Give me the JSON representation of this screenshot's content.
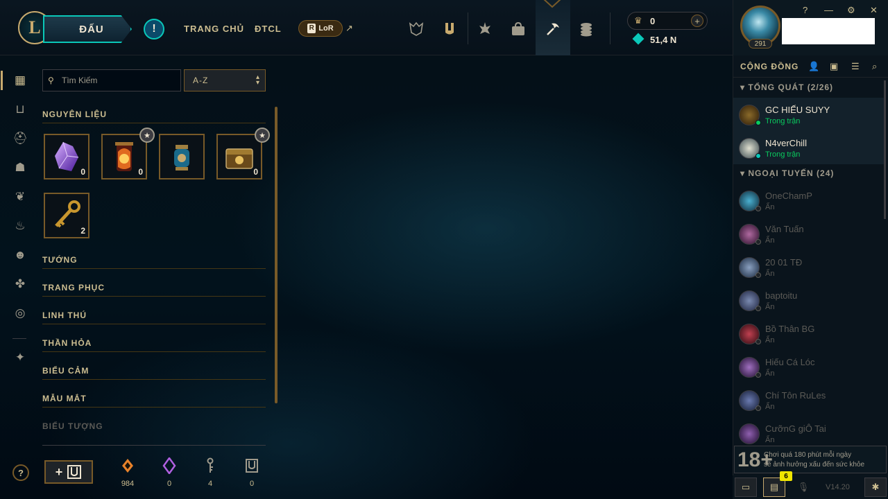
{
  "topbar": {
    "play_label": "ĐẤU",
    "alert_label": "!",
    "nav_home": "TRANG CHỦ",
    "nav_tft": "ĐTCL",
    "lor_label": "LoR",
    "lor_letter": "R",
    "ext_arrow": "↗",
    "icons": [
      "ranked-icon",
      "collection-icon",
      "tft-icon",
      "store-icon",
      "loot-icon",
      "currency-icon"
    ],
    "rp_value": "0",
    "be_value": "51,4 N",
    "plus": "+"
  },
  "profile": {
    "level": "291",
    "window_controls": [
      "?",
      "—",
      "⚙",
      "✕"
    ]
  },
  "social": {
    "title": "CỘNG ĐỒNG",
    "group_general": "TỔNG QUÁT (2/26)",
    "group_offline": "NGOẠI TUYẾN (24)",
    "online_friends": [
      {
        "name": "GC HIẾU SUYY",
        "status": "Trong trận"
      },
      {
        "name": "N4verChill",
        "status": "Trong trận"
      }
    ],
    "offline_friends": [
      {
        "name": "OneChamP",
        "status": "Ẩn"
      },
      {
        "name": "Văn Tuấn",
        "status": "Ẩn"
      },
      {
        "name": "20 01 TĐ",
        "status": "Ẩn"
      },
      {
        "name": "baptoitu",
        "status": "Ẩn"
      },
      {
        "name": "Bồ Thân BG",
        "status": "Ẩn"
      },
      {
        "name": "Hiếu Cá Lóc",
        "status": "Ẩn"
      },
      {
        "name": "Chí Tôn RuLes",
        "status": "Ẩn"
      },
      {
        "name": "CưỡnG giÔ Tai",
        "status": "Ẩn"
      }
    ],
    "warning_age": "18+",
    "warning_line1": "Chơi quá 180 phút mỗi ngày",
    "warning_line2": "sẽ ảnh hưởng xấu đến sức khỏe",
    "notif_count": "6",
    "version": "V14.20"
  },
  "collection": {
    "search_placeholder": "Tìm Kiếm",
    "sort_value": "A-Z",
    "sections": {
      "materials": "NGUYÊN LIỆU",
      "champions": "TƯỚNG",
      "skins": "TRANG PHỤC",
      "companions": "LINH THÚ",
      "ward_skins": "THẦN HỎA",
      "emotes": "BIỂU CẢM",
      "eye_colors": "MẪU MẮT",
      "icons": "BIỂU TƯỢNG"
    },
    "items": [
      {
        "name": "crystal",
        "count": "0"
      },
      {
        "name": "capsule",
        "count": "0"
      },
      {
        "name": "orb",
        "count": ""
      },
      {
        "name": "chest",
        "count": "0"
      },
      {
        "name": "key",
        "count": "2"
      }
    ],
    "resources": [
      {
        "name": "orange-essence",
        "value": "984"
      },
      {
        "name": "mythic-essence",
        "value": "0"
      },
      {
        "name": "key-fragment",
        "value": "4"
      },
      {
        "name": "chest-token",
        "value": "0"
      }
    ],
    "craft_plus": "+"
  },
  "colors": {
    "gold": "#c8aa6e",
    "teal": "#0ac8b9",
    "online": "#0acb5e",
    "background": "#010a13"
  }
}
